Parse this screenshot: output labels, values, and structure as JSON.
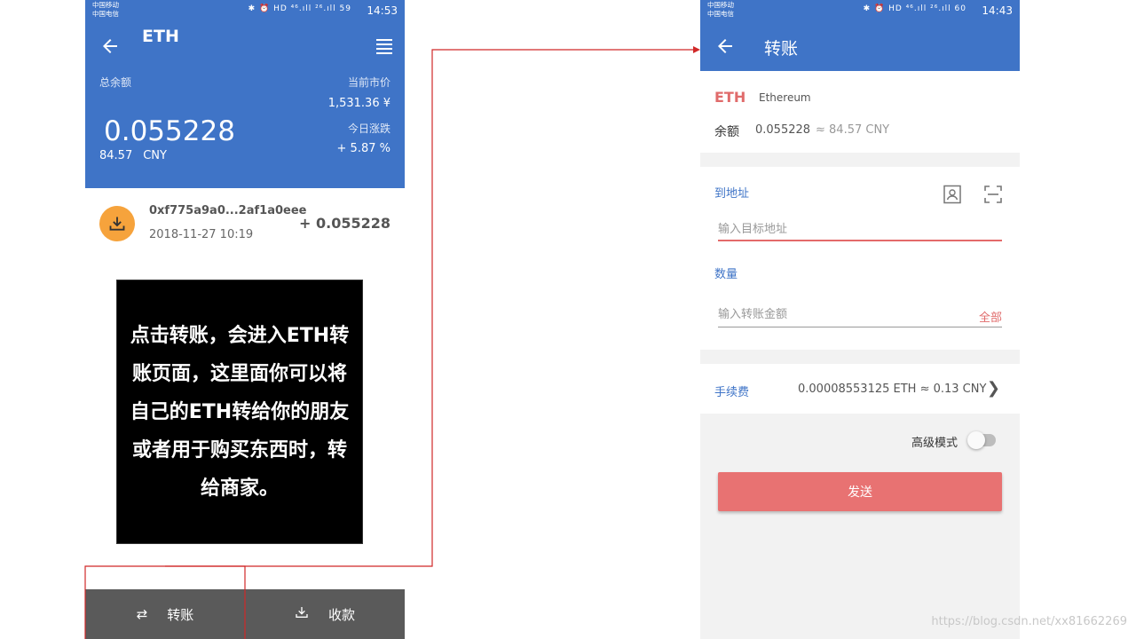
{
  "left_screen": {
    "status": {
      "carrier_1": "中国移动",
      "carrier_2": "中国电信",
      "icons": "✱ ⏰ HD ⁴⁶.ıll ²⁶.ıll 59",
      "time": "14:53"
    },
    "title": "ETH",
    "total_label": "总余额",
    "balance": "0.055228",
    "fiat_value": "84.57",
    "fiat_currency": "CNY",
    "price_label": "当前市价",
    "price_value": "1,531.36 ¥",
    "change_label": "今日涨跌",
    "change_value": "+ 5.87 %",
    "transaction": {
      "address": "0xf775a9a0...2af1a0eee",
      "date": "2018-11-27 10:19",
      "amount": "+ 0.055228"
    },
    "bottom_bar": {
      "send_label": "转账",
      "receive_label": "收款"
    }
  },
  "annotation": {
    "text": "点击转账，会进入ETH转账页面，这里面你可以将自己的ETH转给你的朋友或者用于购买东西时，转给商家。"
  },
  "right_screen": {
    "status": {
      "carrier_1": "中国移动",
      "carrier_2": "中国电信",
      "icons": "✱ ⏰ HD ⁴⁶.ıll ²⁶.ıll 60",
      "time": "14:43"
    },
    "title": "转账",
    "token_symbol": "ETH",
    "token_name": "Ethereum",
    "balance_label": "余额",
    "balance_value": "0.055228",
    "balance_fiat": "≈ 84.57 CNY",
    "to_address_label": "到地址",
    "to_address_placeholder": "输入目标地址",
    "quantity_label": "数量",
    "amount_placeholder": "输入转账金额",
    "all_label": "全部",
    "fee_label": "手续费",
    "fee_value": "0.00008553125 ETH ≈ 0.13 CNY",
    "advanced_label": "高级模式",
    "advanced_enabled": false,
    "send_label": "发送"
  },
  "watermark": "https://blog.csdn.net/xx81662269",
  "colors": {
    "header_blue": "#3f74c7",
    "accent_red": "#e87272",
    "tx_orange": "#f6a33c",
    "bottom_bar": "#5a5a5a",
    "connector": "#d02828"
  }
}
